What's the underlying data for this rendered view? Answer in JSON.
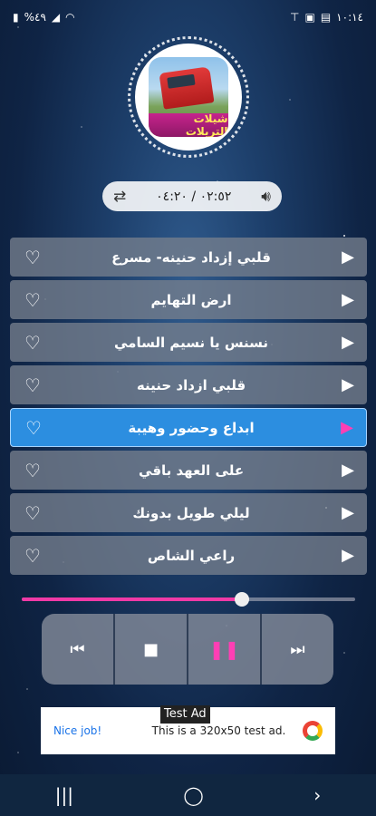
{
  "status_bar": {
    "left_text": "%٤٩",
    "time": "١٠:١٤",
    "icons": [
      "battery-icon",
      "signal-icon",
      "wifi-icon",
      "notification-icon",
      "image-icon",
      "download-icon"
    ]
  },
  "cover": {
    "label": "شيلات التريلات"
  },
  "time_display": {
    "text": "٠٢:٥٢ / ٠٤:٢٠",
    "left_icon": "repeat-icon",
    "right_icon": "volume-icon"
  },
  "playlist": {
    "tracks": [
      {
        "title": "قلبي إزداد حنينه- مسرع",
        "active": false
      },
      {
        "title": "ارض التهايم",
        "active": false
      },
      {
        "title": "نسنس يا نسيم السامي",
        "active": false
      },
      {
        "title": "قلبي ازداد حنينه",
        "active": false
      },
      {
        "title": "ابداع وحضور وهيبة",
        "active": true
      },
      {
        "title": "على العهد باقي",
        "active": false
      },
      {
        "title": "ليلي طويل بدونك",
        "active": false
      },
      {
        "title": "راعي الشاص",
        "active": false
      }
    ]
  },
  "seek": {
    "progress_fraction": 0.66
  },
  "controls": {
    "buttons": [
      "previous-icon",
      "stop-icon",
      "pause-icon",
      "next-icon"
    ]
  },
  "ad": {
    "badge": "Test Ad",
    "nice": "Nice job!",
    "text": "This is a 320x50 test ad."
  },
  "colors": {
    "accent": "#ff3fb4",
    "active_row": "#2c8ee0"
  }
}
